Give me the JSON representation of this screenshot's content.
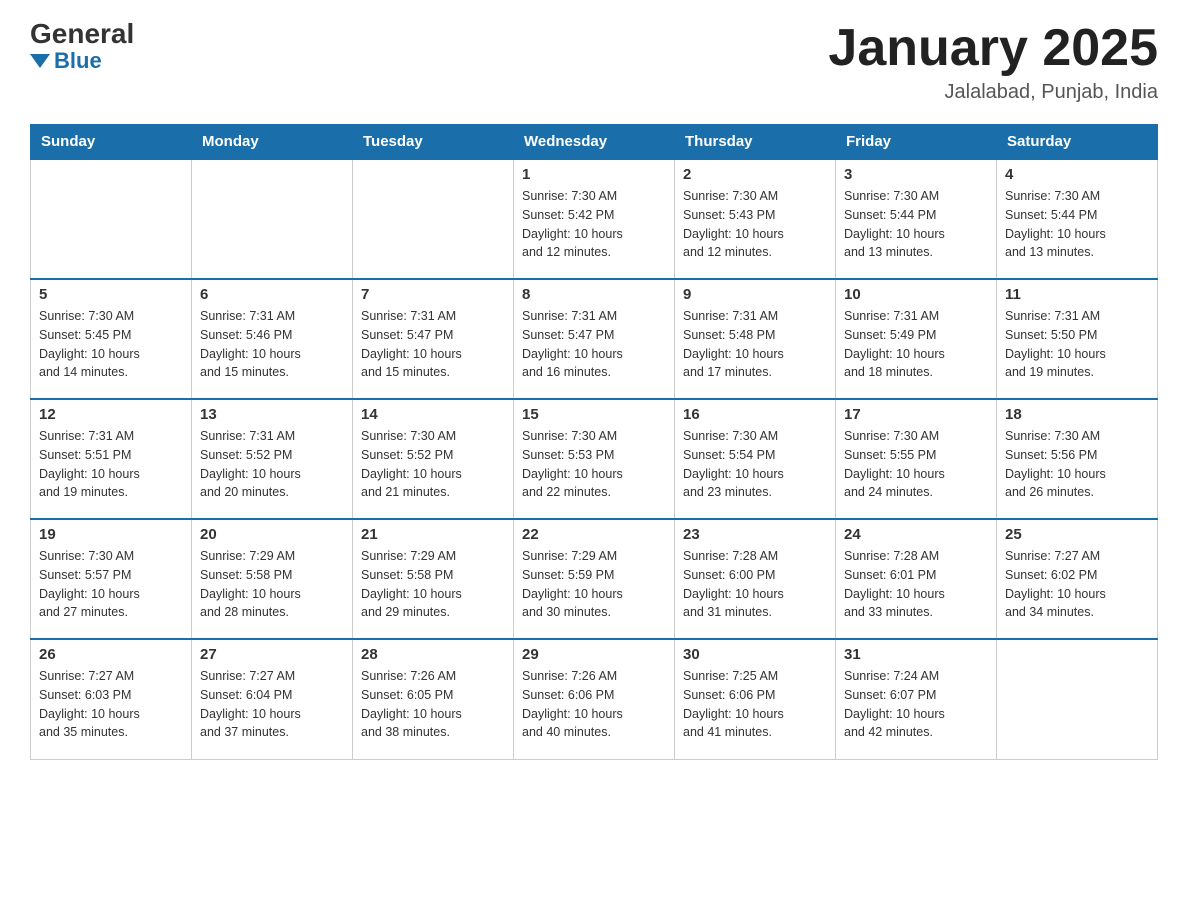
{
  "logo": {
    "general": "General",
    "blue": "Blue"
  },
  "title": "January 2025",
  "subtitle": "Jalalabad, Punjab, India",
  "headers": [
    "Sunday",
    "Monday",
    "Tuesday",
    "Wednesday",
    "Thursday",
    "Friday",
    "Saturday"
  ],
  "weeks": [
    [
      {
        "day": "",
        "info": ""
      },
      {
        "day": "",
        "info": ""
      },
      {
        "day": "",
        "info": ""
      },
      {
        "day": "1",
        "info": "Sunrise: 7:30 AM\nSunset: 5:42 PM\nDaylight: 10 hours\nand 12 minutes."
      },
      {
        "day": "2",
        "info": "Sunrise: 7:30 AM\nSunset: 5:43 PM\nDaylight: 10 hours\nand 12 minutes."
      },
      {
        "day": "3",
        "info": "Sunrise: 7:30 AM\nSunset: 5:44 PM\nDaylight: 10 hours\nand 13 minutes."
      },
      {
        "day": "4",
        "info": "Sunrise: 7:30 AM\nSunset: 5:44 PM\nDaylight: 10 hours\nand 13 minutes."
      }
    ],
    [
      {
        "day": "5",
        "info": "Sunrise: 7:30 AM\nSunset: 5:45 PM\nDaylight: 10 hours\nand 14 minutes."
      },
      {
        "day": "6",
        "info": "Sunrise: 7:31 AM\nSunset: 5:46 PM\nDaylight: 10 hours\nand 15 minutes."
      },
      {
        "day": "7",
        "info": "Sunrise: 7:31 AM\nSunset: 5:47 PM\nDaylight: 10 hours\nand 15 minutes."
      },
      {
        "day": "8",
        "info": "Sunrise: 7:31 AM\nSunset: 5:47 PM\nDaylight: 10 hours\nand 16 minutes."
      },
      {
        "day": "9",
        "info": "Sunrise: 7:31 AM\nSunset: 5:48 PM\nDaylight: 10 hours\nand 17 minutes."
      },
      {
        "day": "10",
        "info": "Sunrise: 7:31 AM\nSunset: 5:49 PM\nDaylight: 10 hours\nand 18 minutes."
      },
      {
        "day": "11",
        "info": "Sunrise: 7:31 AM\nSunset: 5:50 PM\nDaylight: 10 hours\nand 19 minutes."
      }
    ],
    [
      {
        "day": "12",
        "info": "Sunrise: 7:31 AM\nSunset: 5:51 PM\nDaylight: 10 hours\nand 19 minutes."
      },
      {
        "day": "13",
        "info": "Sunrise: 7:31 AM\nSunset: 5:52 PM\nDaylight: 10 hours\nand 20 minutes."
      },
      {
        "day": "14",
        "info": "Sunrise: 7:30 AM\nSunset: 5:52 PM\nDaylight: 10 hours\nand 21 minutes."
      },
      {
        "day": "15",
        "info": "Sunrise: 7:30 AM\nSunset: 5:53 PM\nDaylight: 10 hours\nand 22 minutes."
      },
      {
        "day": "16",
        "info": "Sunrise: 7:30 AM\nSunset: 5:54 PM\nDaylight: 10 hours\nand 23 minutes."
      },
      {
        "day": "17",
        "info": "Sunrise: 7:30 AM\nSunset: 5:55 PM\nDaylight: 10 hours\nand 24 minutes."
      },
      {
        "day": "18",
        "info": "Sunrise: 7:30 AM\nSunset: 5:56 PM\nDaylight: 10 hours\nand 26 minutes."
      }
    ],
    [
      {
        "day": "19",
        "info": "Sunrise: 7:30 AM\nSunset: 5:57 PM\nDaylight: 10 hours\nand 27 minutes."
      },
      {
        "day": "20",
        "info": "Sunrise: 7:29 AM\nSunset: 5:58 PM\nDaylight: 10 hours\nand 28 minutes."
      },
      {
        "day": "21",
        "info": "Sunrise: 7:29 AM\nSunset: 5:58 PM\nDaylight: 10 hours\nand 29 minutes."
      },
      {
        "day": "22",
        "info": "Sunrise: 7:29 AM\nSunset: 5:59 PM\nDaylight: 10 hours\nand 30 minutes."
      },
      {
        "day": "23",
        "info": "Sunrise: 7:28 AM\nSunset: 6:00 PM\nDaylight: 10 hours\nand 31 minutes."
      },
      {
        "day": "24",
        "info": "Sunrise: 7:28 AM\nSunset: 6:01 PM\nDaylight: 10 hours\nand 33 minutes."
      },
      {
        "day": "25",
        "info": "Sunrise: 7:27 AM\nSunset: 6:02 PM\nDaylight: 10 hours\nand 34 minutes."
      }
    ],
    [
      {
        "day": "26",
        "info": "Sunrise: 7:27 AM\nSunset: 6:03 PM\nDaylight: 10 hours\nand 35 minutes."
      },
      {
        "day": "27",
        "info": "Sunrise: 7:27 AM\nSunset: 6:04 PM\nDaylight: 10 hours\nand 37 minutes."
      },
      {
        "day": "28",
        "info": "Sunrise: 7:26 AM\nSunset: 6:05 PM\nDaylight: 10 hours\nand 38 minutes."
      },
      {
        "day": "29",
        "info": "Sunrise: 7:26 AM\nSunset: 6:06 PM\nDaylight: 10 hours\nand 40 minutes."
      },
      {
        "day": "30",
        "info": "Sunrise: 7:25 AM\nSunset: 6:06 PM\nDaylight: 10 hours\nand 41 minutes."
      },
      {
        "day": "31",
        "info": "Sunrise: 7:24 AM\nSunset: 6:07 PM\nDaylight: 10 hours\nand 42 minutes."
      },
      {
        "day": "",
        "info": ""
      }
    ]
  ]
}
